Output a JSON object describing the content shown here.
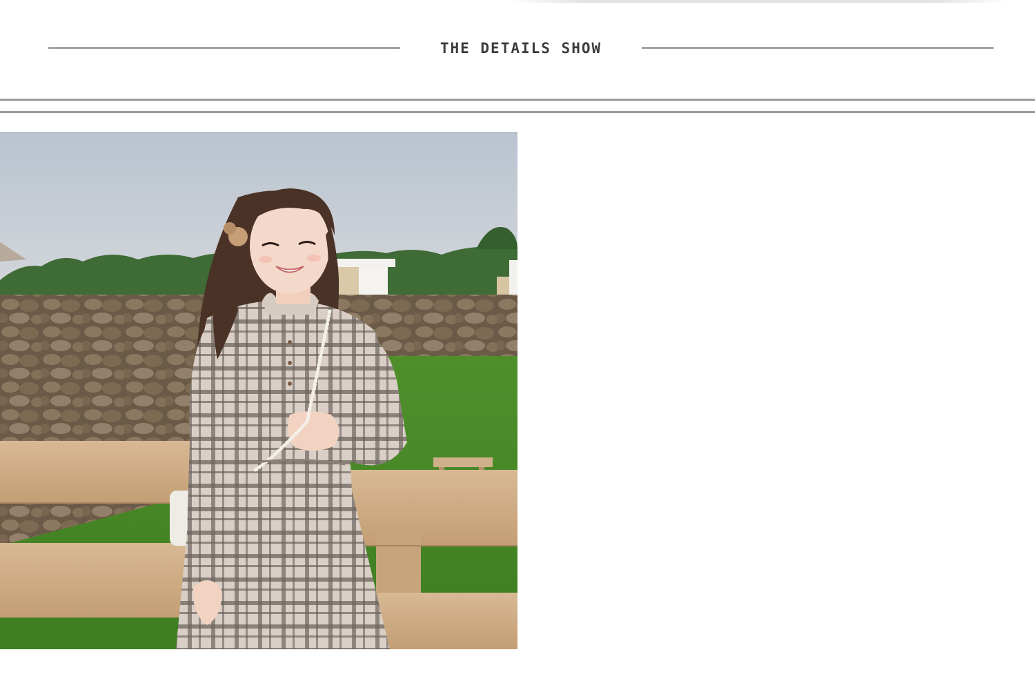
{
  "section": {
    "title": "THE DETAILS SHOW"
  },
  "photo": {
    "subject": "model in plaid long-sleeve dress with ruffled collar leaning on wooden fence"
  }
}
